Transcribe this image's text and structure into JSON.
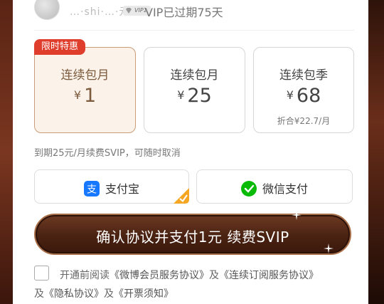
{
  "user": {
    "name": "…·shi·…·元",
    "vip_level": "VIP1",
    "status": "VIP已过期75天"
  },
  "promo_tag": "限时特惠",
  "plans": [
    {
      "name": "连续包月",
      "currency": "¥",
      "price": "1",
      "sub": "",
      "selected": true
    },
    {
      "name": "连续包月",
      "currency": "¥",
      "price": "25",
      "sub": "",
      "selected": false
    },
    {
      "name": "连续包季",
      "currency": "¥",
      "price": "68",
      "sub": "折合¥22.7/月",
      "selected": false
    }
  ],
  "renew_note": "到期25元/月续费SVIP，可随时取消",
  "payment": {
    "alipay_label": "支付宝",
    "wechat_label": "微信支付",
    "selected": "alipay",
    "colors": {
      "alipay": "#1677ff",
      "wechat": "#09bb07",
      "check": "#f5a623"
    }
  },
  "confirm_label": "确认协议并支付1元 续费SVIP",
  "agreement": {
    "prefix": "开通前阅读",
    "link1": "《微博会员服务协议》",
    "and1": "及",
    "link2": "《连续订阅服务协议》",
    "and2": "及",
    "link3": "《隐私协议》",
    "and3": "及",
    "link4": "《开票须知》"
  },
  "colors": {
    "accent_red": "#e03e2d",
    "brown": "#4a2212",
    "gold": "#c89c78"
  }
}
